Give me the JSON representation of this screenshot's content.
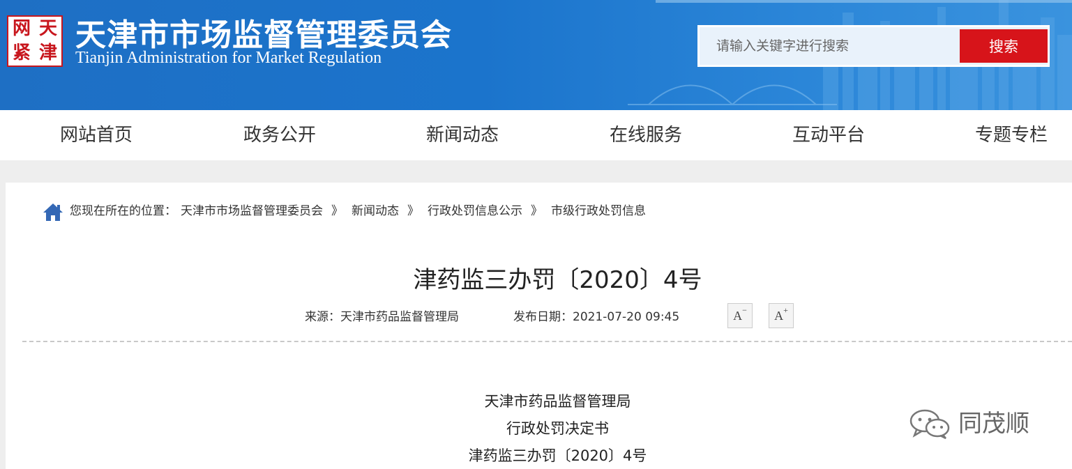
{
  "header": {
    "seal_chars": [
      "天",
      "津",
      "紧",
      "网"
    ],
    "title": "天津市市场监督管理委员会",
    "subtitle": "Tianjin Administration for Market Regulation",
    "search": {
      "placeholder": "请输入关键字进行搜索",
      "button_label": "搜索"
    }
  },
  "nav": {
    "items": [
      {
        "label": "网站首页"
      },
      {
        "label": "政务公开"
      },
      {
        "label": "新闻动态"
      },
      {
        "label": "在线服务"
      },
      {
        "label": "互动平台"
      },
      {
        "label": "专题专栏"
      }
    ]
  },
  "breadcrumb": {
    "prefix": "您现在所在的位置：",
    "items": [
      "天津市市场监督管理委员会",
      "新闻动态",
      "行政处罚信息公示",
      "市级行政处罚信息"
    ],
    "separator": "》"
  },
  "article": {
    "title": "津药监三办罚〔2020〕4号",
    "source_label": "来源：天津市药品监督管理局",
    "date_label": "发布日期：2021-07-20 09:45",
    "font_decrease_label": "A",
    "font_decrease_mark": "−",
    "font_increase_label": "A",
    "font_increase_mark": "+",
    "body_lines": [
      "天津市药品监督管理局",
      "行政处罚决定书",
      "津药监三办罚〔2020〕4号"
    ]
  },
  "watermark": {
    "text": "同茂顺"
  },
  "colors": {
    "banner_blue": "#1b74cc",
    "search_red": "#d7141a",
    "seal_red": "#c8161d",
    "home_icon": "#3468b5"
  }
}
